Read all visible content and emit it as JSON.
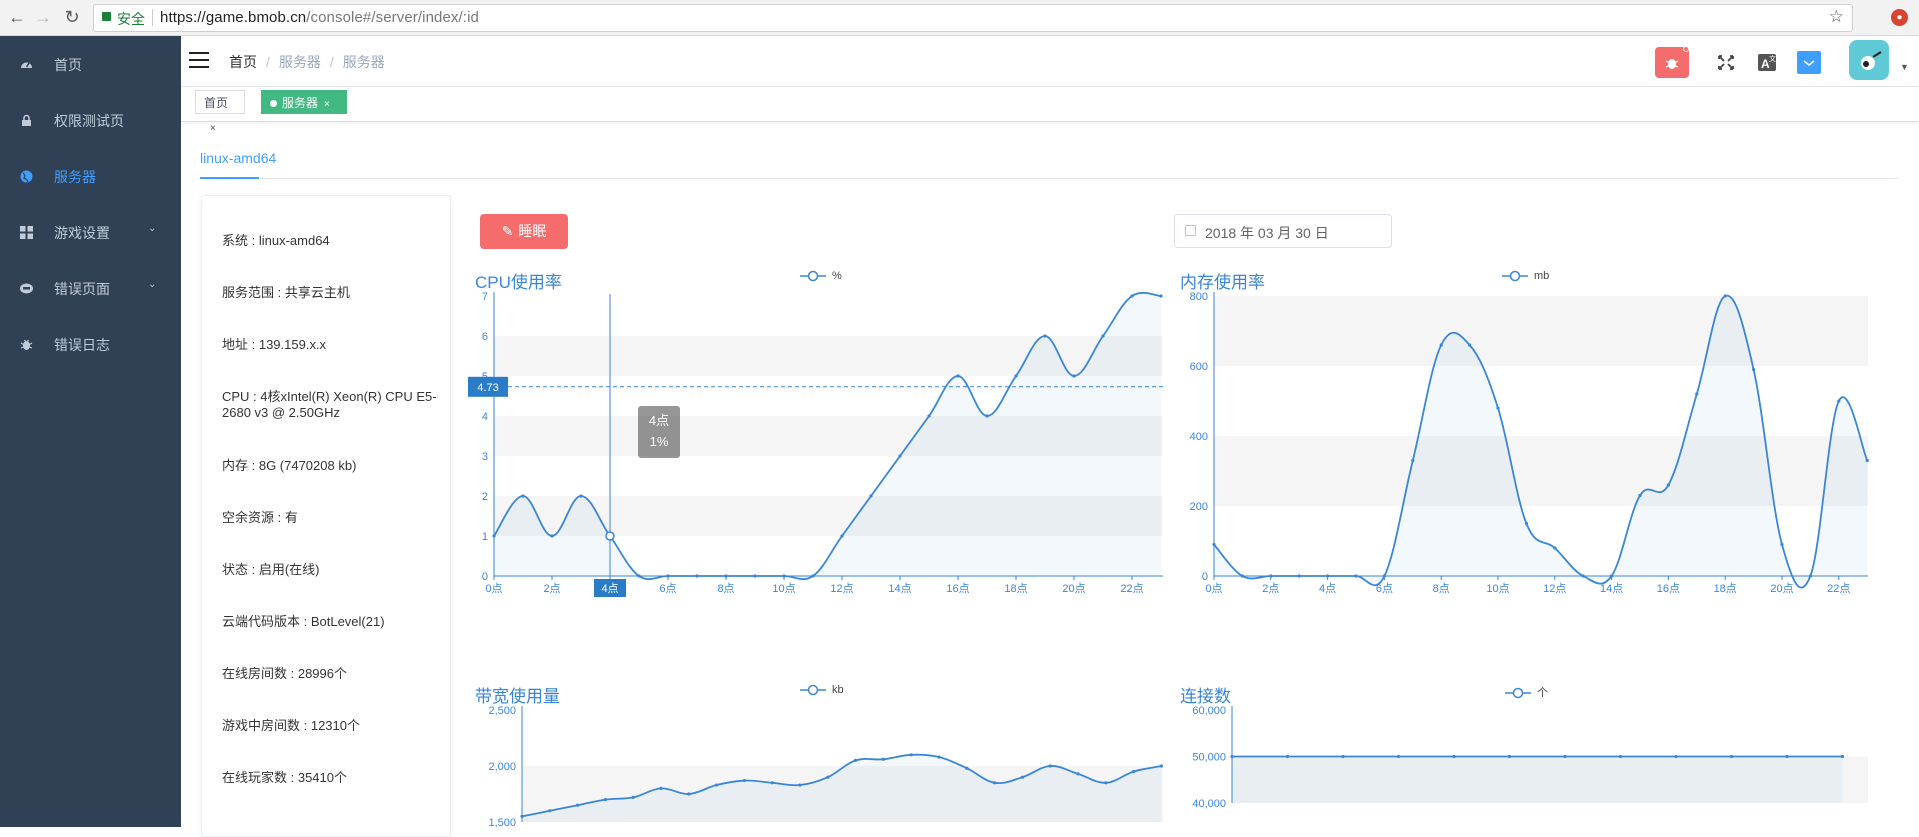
{
  "browser": {
    "secure_label": "安全",
    "url_host": "https://game.bmob.cn",
    "url_path": "/console#/server/index/:id"
  },
  "sidebar": {
    "items": [
      {
        "label": "首页",
        "icon": "dashboard-icon",
        "active": false,
        "expandable": false
      },
      {
        "label": "权限测试页",
        "icon": "lock-icon",
        "active": false,
        "expandable": false
      },
      {
        "label": "服务器",
        "icon": "globe-icon",
        "active": true,
        "expandable": false
      },
      {
        "label": "游戏设置",
        "icon": "grid-icon",
        "active": false,
        "expandable": true
      },
      {
        "label": "错误页面",
        "icon": "404-icon",
        "active": false,
        "expandable": true
      },
      {
        "label": "错误日志",
        "icon": "bug-icon",
        "active": false,
        "expandable": false
      }
    ]
  },
  "header": {
    "breadcrumbs": [
      "首页",
      "服务器",
      "服务器"
    ],
    "icons": [
      "bug-icon",
      "fullscreen-icon",
      "language-icon",
      "size-select-icon",
      "avatar"
    ]
  },
  "tags": [
    {
      "label": "首页",
      "active": false
    },
    {
      "label": "服务器",
      "active": true
    }
  ],
  "server_tab": "linux-amd64",
  "info": [
    "系统 : linux-amd64",
    "服务范围 : 共享云主机",
    "地址 : 139.159.x.x",
    "CPU : 4核xIntel(R) Xeon(R) CPU E5-2680 v3 @ 2.50GHz",
    "内存 : 8G (7470208 kb)",
    "空余资源 : 有",
    "状态 : 启用(在线)",
    "云端代码版本 : BotLevel(21)",
    "在线房间数 : 28996个",
    "游戏中房间数 : 12310个",
    "在线玩家数 : 35410个"
  ],
  "actions": {
    "sleep_label": "睡眠",
    "date_value": "2018 年 03 月 30 日"
  },
  "colors": {
    "accent": "#409eff",
    "danger": "#f56c6c",
    "success": "#42b983",
    "sidebar": "#304156",
    "chart_line": "#3a86d6"
  },
  "chart_data": [
    {
      "type": "line",
      "title": "CPU使用率",
      "legend": "%",
      "x": [
        "0点",
        "1点",
        "2点",
        "3点",
        "4点",
        "5点",
        "6点",
        "7点",
        "8点",
        "9点",
        "10点",
        "11点",
        "12点",
        "13点",
        "14点",
        "15点",
        "16点",
        "17点",
        "18点",
        "19点",
        "20点",
        "21点",
        "22点",
        "23点"
      ],
      "xticks": [
        "0点",
        "2点",
        "4点",
        "6点",
        "8点",
        "10点",
        "12点",
        "14点",
        "16点",
        "18点",
        "20点",
        "22点"
      ],
      "values": [
        1,
        2,
        1,
        2,
        1,
        0,
        0,
        0,
        0,
        0,
        0,
        0,
        1,
        2,
        3,
        4,
        5,
        4,
        5,
        6,
        5,
        6,
        7,
        7
      ],
      "ylim": [
        0,
        7
      ],
      "yticks": [
        0,
        1,
        2,
        3,
        4,
        5,
        6,
        7
      ],
      "tooltip": {
        "x": "4点",
        "lines": [
          "4点",
          "1%"
        ],
        "crosshair_y": "4.73"
      },
      "grid": "banded"
    },
    {
      "type": "line",
      "title": "内存使用率",
      "legend": "mb",
      "x": [
        "0点",
        "1点",
        "2点",
        "3点",
        "4点",
        "5点",
        "6点",
        "7点",
        "8点",
        "9点",
        "10点",
        "11点",
        "12点",
        "13点",
        "14点",
        "15点",
        "16点",
        "17点",
        "18点",
        "19点",
        "20点",
        "21点",
        "22点",
        "23点"
      ],
      "xticks": [
        "0点",
        "2点",
        "4点",
        "6点",
        "8点",
        "10点",
        "12点",
        "14点",
        "16点",
        "18点",
        "20点",
        "22点"
      ],
      "values": [
        90,
        0,
        0,
        0,
        0,
        0,
        0,
        330,
        660,
        660,
        480,
        150,
        80,
        0,
        0,
        230,
        260,
        520,
        800,
        590,
        90,
        0,
        500,
        330
      ],
      "ylim": [
        0,
        800
      ],
      "yticks": [
        0,
        200,
        400,
        600,
        800
      ],
      "grid": "banded"
    },
    {
      "type": "line",
      "title": "带宽使用量",
      "legend": "kb",
      "values": [
        1550,
        1600,
        1650,
        1700,
        1720,
        1800,
        1750,
        1830,
        1870,
        1850,
        1830,
        1900,
        2050,
        2060,
        2100,
        2080,
        1980,
        1850,
        1900,
        2000,
        1930,
        1850,
        1950,
        2000
      ],
      "ylim": [
        1500,
        2500
      ],
      "yticks": [
        "1,500",
        "2,000",
        "2,500"
      ],
      "ytick_values": [
        1500,
        2000,
        2500
      ],
      "grid": "banded"
    },
    {
      "type": "line",
      "title": "连接数",
      "legend": "个",
      "values": [
        50000,
        50000,
        50000,
        50000,
        50000,
        50000,
        50000,
        50000,
        50000,
        50000,
        50000,
        50000
      ],
      "ylim": [
        40000,
        60000
      ],
      "yticks": [
        "40,000",
        "50,000",
        "60,000"
      ],
      "ytick_values": [
        40000,
        50000,
        60000
      ],
      "grid": "banded"
    }
  ]
}
